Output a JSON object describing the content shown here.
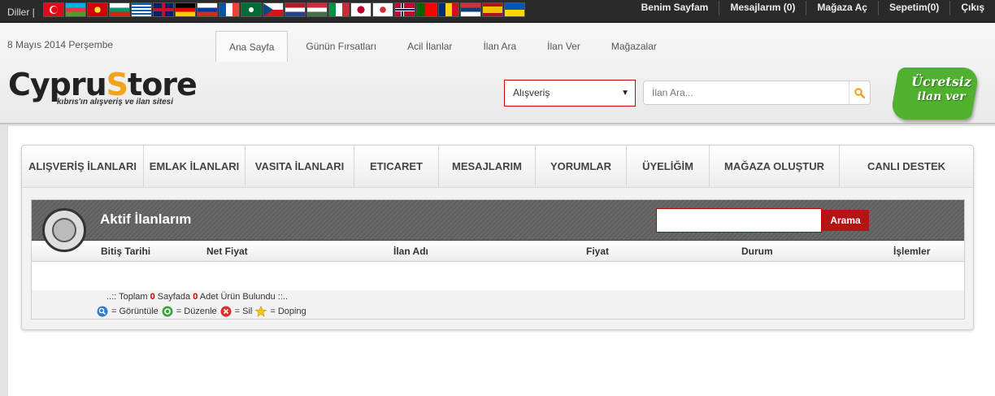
{
  "topbar": {
    "langs_label": "Diller |",
    "flags": [
      "tr",
      "az",
      "mk",
      "bg",
      "gr",
      "gb",
      "de",
      "ru",
      "fr",
      "sa",
      "cz",
      "nl",
      "hu",
      "it",
      "jp",
      "kr",
      "no",
      "pt",
      "ro",
      "rs",
      "es",
      "ua"
    ],
    "nav": [
      "Benim Sayfam",
      "Mesajlarım (0)",
      "Mağaza Aç",
      "Sepetim(0)",
      "Çıkış"
    ]
  },
  "header": {
    "date": "8 Mayıs 2014 Perşembe",
    "tabs": [
      "Ana Sayfa",
      "Günün Fırsatları",
      "Acil İlanlar",
      "İlan Ara",
      "İlan Ver",
      "Mağazalar"
    ],
    "logo_main_a": "Cypru",
    "logo_main_s": "S",
    "logo_main_b": "tore",
    "logo_sub": "kıbrıs'ın alışveriş ve ilan sitesi",
    "category_select": "Alışveriş",
    "search_placeholder": "İlan Ara...",
    "badge_line1": "Ücretsiz",
    "badge_line2": "ilan ver"
  },
  "mainnav": [
    "ALIŞVERİŞ İLANLARI",
    "EMLAK İLANLARI",
    "VASITA İLANLARI",
    "ETICARET",
    "MESAJLARIM",
    "YORUMLAR",
    "ÜYELİĞİM",
    "MAĞAZA OLUŞTUR",
    "CANLI DESTEK"
  ],
  "listing": {
    "title": "Aktif İlanlarım",
    "search_button": "Arama",
    "columns": [
      "Bitiş Tarihi",
      "Net Fiyat",
      "İlan Adı",
      "Fiyat",
      "Durum",
      "İşlemler"
    ],
    "summary_prefix": "..:: Toplam ",
    "summary_count1": "0",
    "summary_mid": " Sayfada ",
    "summary_count2": "0",
    "summary_suffix": " Adet Ürün Bulundu ::..",
    "legend": [
      "= Görüntüle",
      "= Düzenle",
      "= Sil",
      "= Doping"
    ]
  }
}
